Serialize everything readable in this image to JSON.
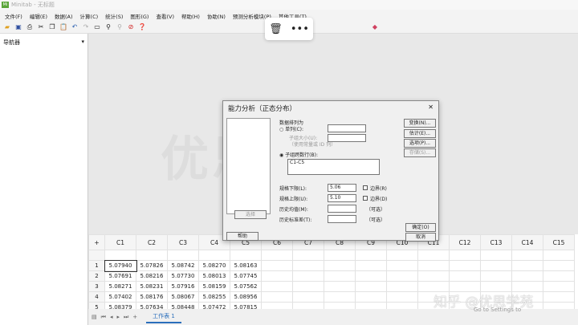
{
  "window": {
    "title": "Minitab - 无标题",
    "logo": "Mi"
  },
  "menu": [
    "文件(F)",
    "编辑(E)",
    "数据(A)",
    "计算(C)",
    "统计(S)",
    "图形(G)",
    "查看(V)",
    "帮助(H)",
    "协助(N)",
    "预测分析模块(P)",
    "其他工具(T)"
  ],
  "navigator": {
    "title": "导航器"
  },
  "watermark": "优思学苑",
  "dialog": {
    "title": "能力分析（正态分布）",
    "arranged_label": "数据排列为",
    "single_column": "单列(C):",
    "subgroup_size": "子组大小(U):",
    "subgroup_hint": "（使用常量或 ID 列）",
    "across_rows": "子组跨数行(B):",
    "across_rows_value": "C1-C5",
    "lsl_label": "规格下限(L):",
    "lsl_value": "5.06",
    "usl_label": "规格上限(U):",
    "usl_value": "5.10",
    "boundary_lower": "边界(R)",
    "boundary_upper": "边界(D)",
    "hist_mean": "历史均值(M):",
    "hist_sd": "历史标准差(T):",
    "optional": "（可选）",
    "buttons": {
      "transform": "变换(N)...",
      "estimate": "估计(E)...",
      "options": "选项(P)...",
      "storage": "存储(S)...",
      "select": "选择",
      "help": "帮助",
      "ok": "确定(O)",
      "cancel": "取消"
    }
  },
  "grid": {
    "columns": [
      "C1",
      "C2",
      "C3",
      "C4",
      "C5",
      "C6",
      "C7",
      "C8",
      "C9",
      "C10",
      "C11",
      "C12",
      "C13",
      "C14",
      "C15"
    ],
    "rows": [
      [
        "1",
        "5.07940",
        "5.07826",
        "5.08742",
        "5.08270",
        "5.08163"
      ],
      [
        "2",
        "5.07691",
        "5.08216",
        "5.07730",
        "5.08013",
        "5.07745"
      ],
      [
        "3",
        "5.08271",
        "5.08231",
        "5.07916",
        "5.08159",
        "5.07562"
      ],
      [
        "4",
        "5.07402",
        "5.08176",
        "5.08067",
        "5.08255",
        "5.08956"
      ],
      [
        "5",
        "5.08379",
        "5.07634",
        "5.08448",
        "5.07472",
        "5.07815"
      ]
    ]
  },
  "sheet_tab": "工作表 1",
  "overlay": {
    "zhihu": "知乎 @优思学苑",
    "activate": "Go to Settings to"
  }
}
